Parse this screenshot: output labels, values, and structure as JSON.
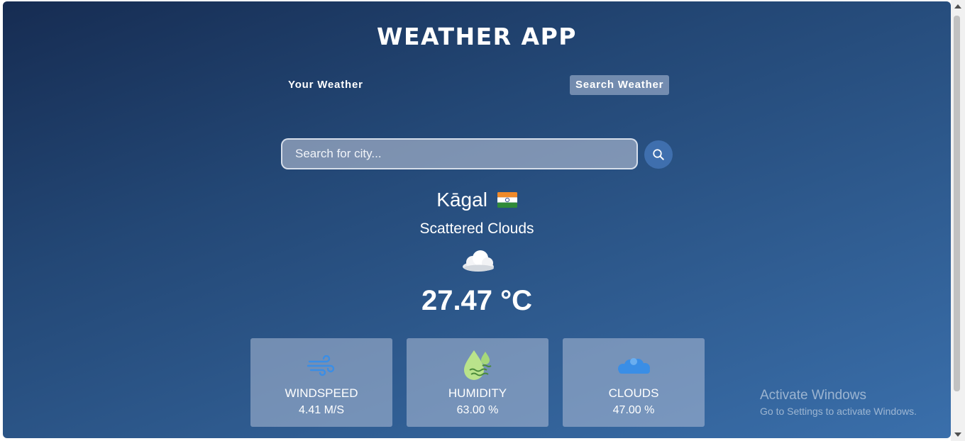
{
  "app": {
    "title": "WEATHER APP"
  },
  "tabs": [
    {
      "label": "Your Weather",
      "active": false
    },
    {
      "label": "Search Weather",
      "active": true
    }
  ],
  "search": {
    "placeholder": "Search for city...",
    "value": "",
    "button_icon": "search-icon"
  },
  "weather": {
    "city": "Kāgal",
    "flag_icon": "india-flag-icon",
    "description": "Scattered Clouds",
    "condition_icon": "cloud-icon",
    "temperature": "27.47 °C"
  },
  "stats": [
    {
      "label": "WINDSPEED",
      "value": "4.41 M/S",
      "icon": "wind-icon"
    },
    {
      "label": "HUMIDITY",
      "value": "63.00 %",
      "icon": "humidity-drop-icon"
    },
    {
      "label": "CLOUDS",
      "value": "47.00 %",
      "icon": "clouds-icon"
    }
  ],
  "watermark": {
    "line1": "Activate Windows",
    "line2": "Go to Settings to activate Windows."
  },
  "colors": {
    "background_top": "#162c52",
    "background_bottom": "#3a6fab",
    "accent": "#3f6fae"
  }
}
